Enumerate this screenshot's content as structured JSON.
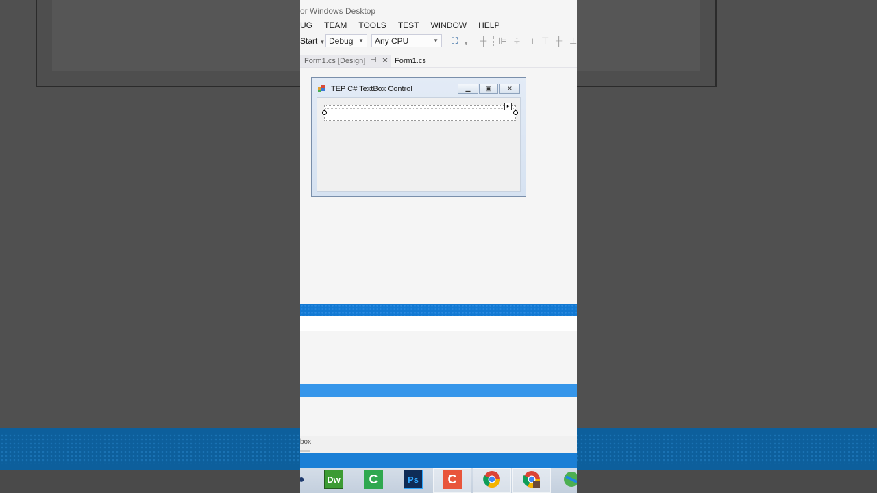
{
  "window": {
    "title": "or Windows Desktop"
  },
  "menu": [
    "UG",
    "TEAM",
    "TOOLS",
    "TEST",
    "WINDOW",
    "HELP"
  ],
  "toolbar": {
    "start_label": "Start",
    "configuration": "Debug",
    "platform": "Any CPU"
  },
  "tabs": [
    {
      "label": "Form1.cs [Design]",
      "active": false
    },
    {
      "label": "Form1.cs",
      "active": true
    }
  ],
  "designer": {
    "form_title": "TEP C# TextBox Control",
    "textbox_value": ""
  },
  "status": {
    "text": "box"
  },
  "taskbar": {
    "apps": [
      {
        "name": "dreamweaver-icon",
        "label": "Dw",
        "color": "#3c9b33"
      },
      {
        "name": "camtasia-icon",
        "label": "C",
        "color": "#2fa84f"
      },
      {
        "name": "photoshop-icon",
        "label": "Ps",
        "color": "#0f2c56"
      },
      {
        "name": "snagit-icon",
        "label": "C",
        "color": "#e8553b"
      },
      {
        "name": "chrome-icon",
        "label": "",
        "color": "#db4437"
      },
      {
        "name": "chrome-user-icon",
        "label": "",
        "color": "#db4437"
      },
      {
        "name": "app-icon",
        "label": "",
        "color": "#4caf50"
      }
    ]
  },
  "colors": {
    "accent": "#1279d3",
    "accent_light": "#3696ea",
    "panel_bg": "#f5f5f5"
  }
}
